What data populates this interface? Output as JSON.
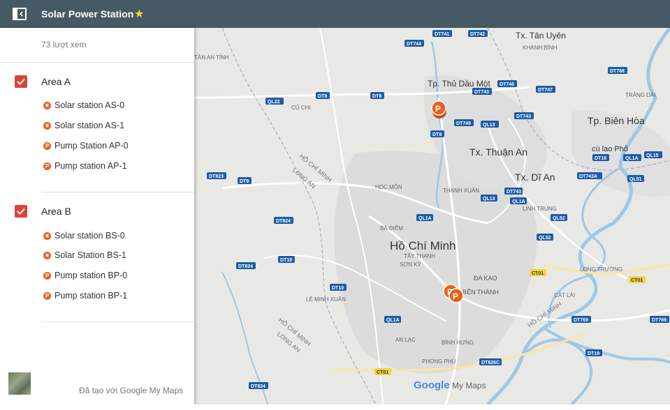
{
  "header": {
    "title": "Solar Power Station",
    "star": "★"
  },
  "panel": {
    "views": "73 lượt xem",
    "footer": "Đã tạo với Google My Maps"
  },
  "layers": [
    {
      "title": "Area A",
      "items": [
        {
          "label": "Solar station AS-0",
          "icon": "solar-icon"
        },
        {
          "label": "Solar station AS-1",
          "icon": "solar-icon"
        },
        {
          "label": "Pump Station AP-0",
          "icon": "parking-p-icon"
        },
        {
          "label": "Pump station AP-1",
          "icon": "parking-p-icon"
        }
      ]
    },
    {
      "title": "Area B",
      "items": [
        {
          "label": "Solar station BS-0",
          "icon": "solar-icon"
        },
        {
          "label": "Solar Station BS-1",
          "icon": "solar-icon"
        },
        {
          "label": "Pump station BP-0",
          "icon": "parking-p-icon"
        },
        {
          "label": "Pump station BP-1",
          "icon": "parking-p-icon"
        }
      ]
    }
  ],
  "map": {
    "brand_google": "Google",
    "brand_mymaps": "My Maps",
    "places": [
      "Tp. Thủ Dầu Một",
      "Tx. Tân Uyên",
      "KHÁNH BÌNH",
      "Tp. Biên Hòa",
      "Tx. Thuận An",
      "Tx. Dĩ An",
      "Hồ Chí Minh",
      "HÓC MÔN",
      "CỦ CHI",
      "BÀ ĐIỂM",
      "TÂY THẠNH",
      "SƠN KỲ",
      "ĐA KAO",
      "BẾN THÀNH",
      "LÊ MINH XUÂN",
      "AN LẠC",
      "BÌNH HƯNG",
      "PHONG PHÚ",
      "THẠNH XUÂN",
      "LINH TRUNG",
      "LONG TRƯỜNG",
      "CÁT LÁI",
      "cù lao Phố",
      "TRẢNG DÀI",
      "TÂN AN TỈNH",
      "HỒ CHÍ MINH",
      "LONG AN"
    ],
    "roads": [
      "DT741",
      "DT742",
      "DT744",
      "DT768",
      "DT746",
      "DT743",
      "DT747",
      "DT8",
      "QL22",
      "DT745",
      "QL13",
      "DT9",
      "DT743",
      "DT16",
      "QL1A",
      "QL15",
      "DT743A",
      "DT823",
      "QL51",
      "QL13",
      "DT743",
      "QL1A",
      "QL1A",
      "QL52",
      "DT824",
      "DT10",
      "QL52",
      "DT824",
      "DT10",
      "CT01",
      "CT01",
      "QL1A",
      "DT769",
      "DT769",
      "DT826C",
      "DT19",
      "CT01",
      "DT824"
    ]
  },
  "colors": {
    "accent": "#db4437",
    "header": "#455a64",
    "marker": "#e8601c"
  }
}
